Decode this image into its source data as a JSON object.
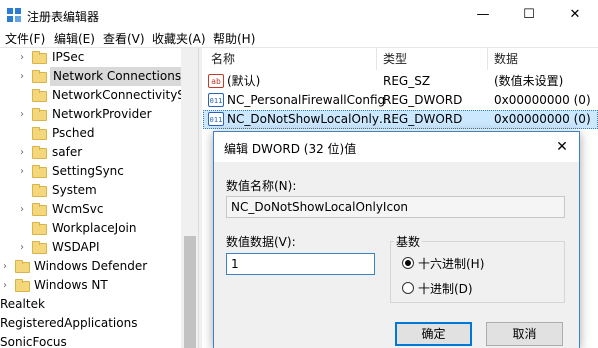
{
  "window": {
    "title": "注册表编辑器",
    "minimize": "—",
    "maximize": "☐",
    "close": "✕"
  },
  "menu": [
    "文件(F)",
    "编辑(E)",
    "查看(V)",
    "收藏夹(A)",
    "帮助(H)"
  ],
  "tree": {
    "items": [
      {
        "label": "IPSec",
        "expander": "›"
      },
      {
        "label": "Network Connections",
        "expander": "›",
        "selected": true
      },
      {
        "label": "NetworkConnectivityStat",
        "expander": ""
      },
      {
        "label": "NetworkProvider",
        "expander": "›"
      },
      {
        "label": "Psched",
        "expander": ""
      },
      {
        "label": "safer",
        "expander": "›"
      },
      {
        "label": "SettingSync",
        "expander": "›"
      },
      {
        "label": "System",
        "expander": ""
      },
      {
        "label": "WcmSvc",
        "expander": "›"
      },
      {
        "label": "WorkplaceJoin",
        "expander": ""
      },
      {
        "label": "WSDAPI",
        "expander": "›"
      },
      {
        "label": "Windows Defender",
        "expander": "›"
      },
      {
        "label": "Windows NT",
        "expander": "›"
      },
      {
        "label": "Realtek",
        "expander": ""
      },
      {
        "label": "RegisteredApplications",
        "expander": ""
      },
      {
        "label": "SonicFocus",
        "expander": ""
      }
    ]
  },
  "list": {
    "columns": [
      "名称",
      "类型",
      "数据"
    ],
    "rows": [
      {
        "name": "(默认)",
        "type": "REG_SZ",
        "data": "(数值未设置)",
        "icon": "ab"
      },
      {
        "name": "NC_PersonalFirewallConfig",
        "type": "REG_DWORD",
        "data": "0x00000000 (0)",
        "icon": "011"
      },
      {
        "name": "NC_DoNotShowLocalOnly…",
        "type": "REG_DWORD",
        "data": "0x00000000 (0)",
        "icon": "011"
      }
    ]
  },
  "dialog": {
    "title": "编辑 DWORD (32 位)值",
    "close": "✕",
    "value_name_label": "数值名称(N):",
    "value_name": "NC_DoNotShowLocalOnlyIcon",
    "value_data_label": "数值数据(V):",
    "value_data": "1",
    "base_label": "基数",
    "hex_label": "十六进制(H)",
    "dec_label": "十进制(D)",
    "hex_selected": true,
    "ok": "确定",
    "cancel": "取消"
  }
}
